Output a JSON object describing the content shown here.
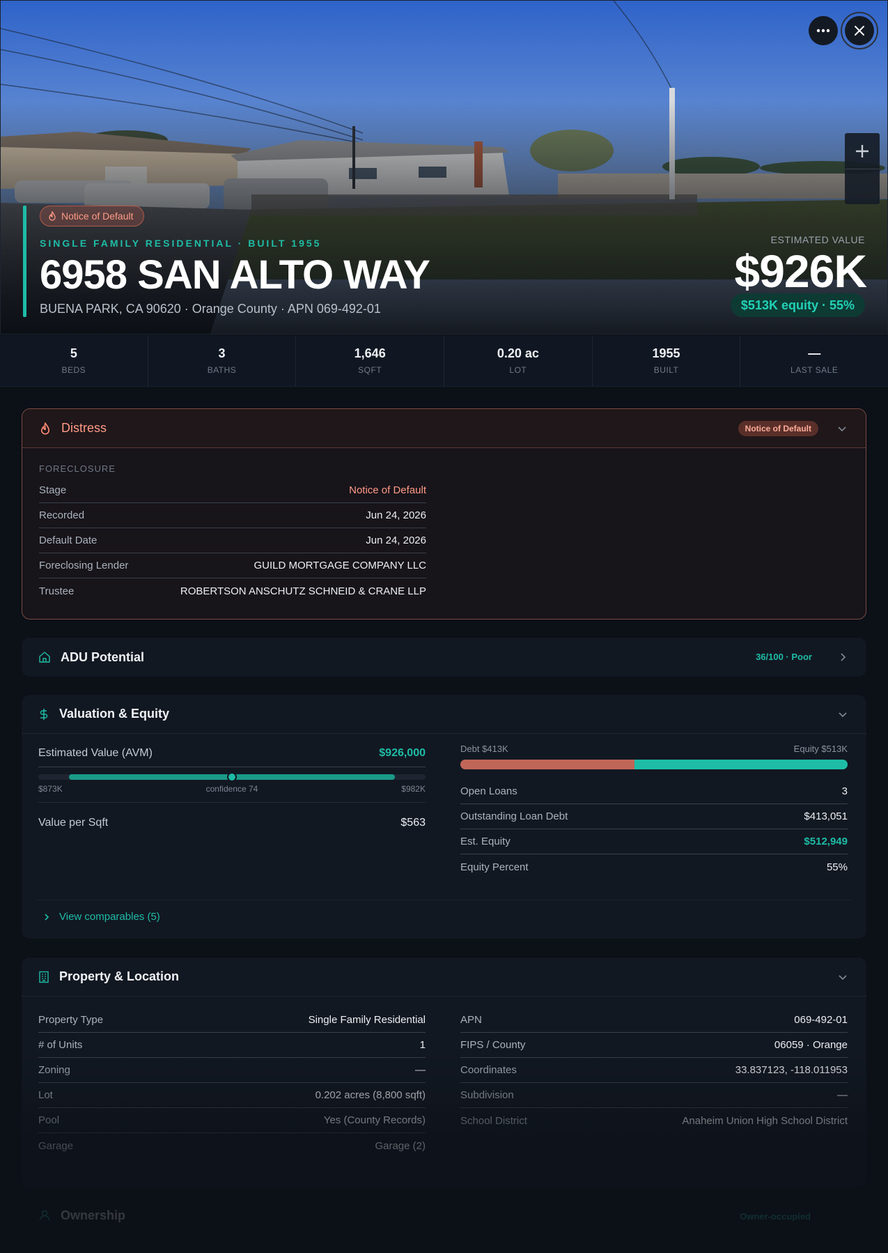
{
  "hero": {
    "badge": "Notice of Default",
    "subtitle": "SINGLE FAMILY RESIDENTIAL · BUILT 1955",
    "title": "6958 SAN ALTO WAY",
    "address": "BUENA PARK, CA 90620 · Orange County · APN 069-492-01",
    "estimated_label": "ESTIMATED VALUE",
    "estimated_value": "$926K",
    "equity_pill": "$513K equity · 55%"
  },
  "stats": [
    {
      "value": "5",
      "label": "BEDS"
    },
    {
      "value": "3",
      "label": "BATHS"
    },
    {
      "value": "1,646",
      "label": "SQFT"
    },
    {
      "value": "0.20 ac",
      "label": "LOT"
    },
    {
      "value": "1955",
      "label": "BUILT"
    },
    {
      "value": "—",
      "label": "LAST SALE"
    }
  ],
  "distress": {
    "title": "Distress",
    "badge": "Notice of Default",
    "section": "FORECLOSURE",
    "rows": [
      {
        "k": "Stage",
        "v": "Notice of Default"
      },
      {
        "k": "Recorded",
        "v": "Jun 24, 2026"
      },
      {
        "k": "Default Date",
        "v": "Jun 24, 2026"
      },
      {
        "k": "Foreclosing Lender",
        "v": "GUILD MORTGAGE COMPANY LLC"
      },
      {
        "k": "Trustee",
        "v": "ROBERTSON ANSCHUTZ SCHNEID & CRANE LLP"
      }
    ]
  },
  "adu": {
    "title": "ADU Potential",
    "score": "36/100 · Poor"
  },
  "valuation": {
    "title": "Valuation & Equity",
    "avm_label": "Estimated Value (AVM)",
    "avm_value": "$926,000",
    "range_low": "$873K",
    "range_high": "$982K",
    "confidence": "confidence 74",
    "range_fill_start": 0.08,
    "range_fill_end": 0.92,
    "range_marker": 0.5,
    "vps_label": "Value per Sqft",
    "vps_value": "$563",
    "debt_label": "Debt $413K",
    "equity_label": "Equity $513K",
    "debt_fraction": 0.45,
    "rows": [
      {
        "k": "Open Loans",
        "v": "3"
      },
      {
        "k": "Outstanding Loan Debt",
        "v": "$413,051"
      },
      {
        "k": "Est. Equity",
        "v": "$512,949"
      },
      {
        "k": "Equity Percent",
        "v": "55%"
      }
    ],
    "comps": "View comparables (5)"
  },
  "property": {
    "title": "Property & Location",
    "left": [
      {
        "k": "Property Type",
        "v": "Single Family Residential"
      },
      {
        "k": "# of Units",
        "v": "1"
      },
      {
        "k": "Zoning",
        "v": "—"
      },
      {
        "k": "Lot",
        "v": "0.202 acres (8,800 sqft)"
      },
      {
        "k": "Pool",
        "v": "Yes (County Records)"
      },
      {
        "k": "Garage",
        "v": "Garage (2)"
      }
    ],
    "right": [
      {
        "k": "APN",
        "v": "069-492-01"
      },
      {
        "k": "FIPS / County",
        "v": "06059 · Orange"
      },
      {
        "k": "Coordinates",
        "v": "33.837123, -118.011953"
      },
      {
        "k": "Subdivision",
        "v": "—"
      },
      {
        "k": "School District",
        "v": "Anaheim Union High School District"
      }
    ]
  },
  "ownership": {
    "title": "Ownership",
    "badge": "Owner-occupied"
  },
  "colors": {
    "accent": "#1ebca6",
    "distress": "#ff9a86",
    "debt": "#c06658"
  }
}
